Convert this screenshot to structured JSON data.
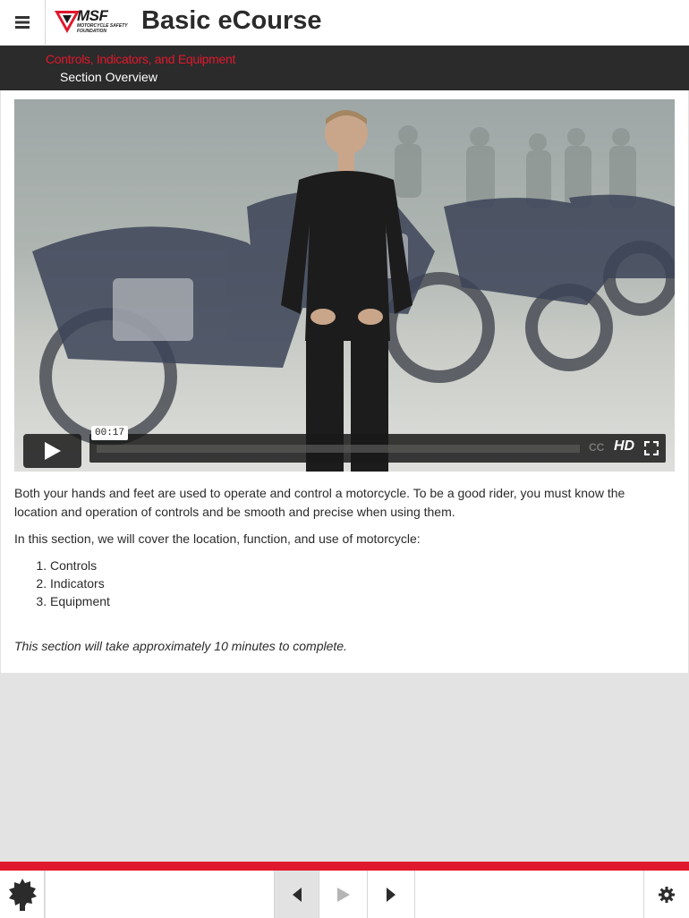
{
  "header": {
    "app_title": "Basic eCourse",
    "logo_text": "MSF",
    "logo_subtext": "MOTORCYCLE SAFETY FOUNDATION",
    "menu_icon": "hamburger-icon"
  },
  "subheader": {
    "course_section": "Controls, Indicators, and Equipment",
    "page_name": "Section Overview"
  },
  "video": {
    "current_time": "00:17",
    "cc_label": "CC",
    "hd_label": "HD",
    "play_icon": "play-icon",
    "fullscreen_icon": "fullscreen-icon"
  },
  "body": {
    "paragraph1": "Both your hands and feet are used to operate and control a motorcycle. To be a good rider, you must know the location and operation of controls and be smooth and precise when using them.",
    "paragraph2": "In this section, we will cover the location, function, and use of motorcycle:",
    "topics": [
      "Controls",
      "Indicators",
      "Equipment"
    ],
    "duration_note": "This section will take approximately 10 minutes to complete."
  },
  "footer": {
    "badge_icon": "badge-icon",
    "prev_icon": "previous-icon",
    "play_icon": "play-icon",
    "next_icon": "next-icon",
    "settings_icon": "gear-icon"
  },
  "colors": {
    "accent_red": "#e0182d",
    "dark_bar": "#2b2b2b",
    "background": "#e3e3e3"
  }
}
